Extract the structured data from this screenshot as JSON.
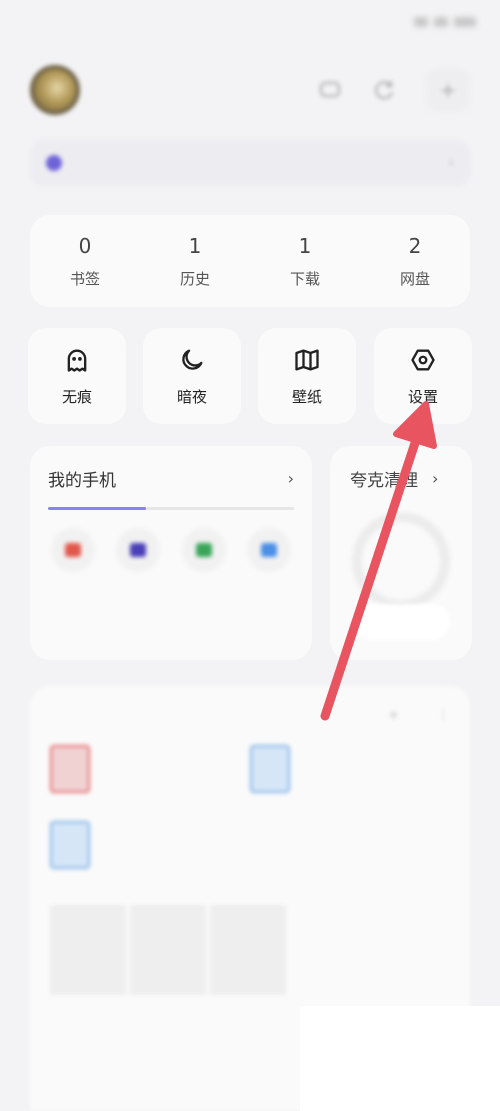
{
  "status_bar": {
    "time": ""
  },
  "profile": {
    "username": ""
  },
  "banner": {
    "text": ""
  },
  "stats": [
    {
      "value": "0",
      "unit": "",
      "label": "书签"
    },
    {
      "value": "1",
      "unit": "",
      "label": "历史"
    },
    {
      "value": "1",
      "unit": "",
      "label": "下载"
    },
    {
      "value": "2",
      "unit": "",
      "label": "网盘"
    }
  ],
  "quick_actions": [
    {
      "label": "无痕",
      "icon": "ghost-icon"
    },
    {
      "label": "暗夜",
      "icon": "moon-icon"
    },
    {
      "label": "壁纸",
      "icon": "book-open-icon"
    },
    {
      "label": "设置",
      "icon": "hexagon-settings-icon"
    }
  ],
  "my_phone": {
    "title": "我的手机",
    "chevron": "›",
    "subtitle": "",
    "apps": [
      {
        "label": "",
        "sub": "",
        "color": "#e2574c"
      },
      {
        "label": "",
        "sub": "",
        "color": "#4a3fb8"
      },
      {
        "label": "",
        "sub": "",
        "color": "#3aa55a"
      },
      {
        "label": "",
        "sub": "",
        "color": "#4c8fe6"
      }
    ]
  },
  "clean": {
    "title": "夸克清理",
    "chevron": "›",
    "button": ""
  },
  "recent_docs": {
    "title": "",
    "section": "",
    "docs": [
      {
        "line1": "",
        "line2": "",
        "meta": "",
        "color": "#e4676a"
      },
      {
        "line1": "",
        "line2": "",
        "meta": "",
        "color": "#7fb2e8"
      },
      {
        "line1": "",
        "line2": "",
        "meta": "",
        "color": "#7fb2e8"
      }
    ],
    "recent_section": "",
    "recent_sub": ""
  },
  "annotation": {
    "color": "#e85560"
  }
}
